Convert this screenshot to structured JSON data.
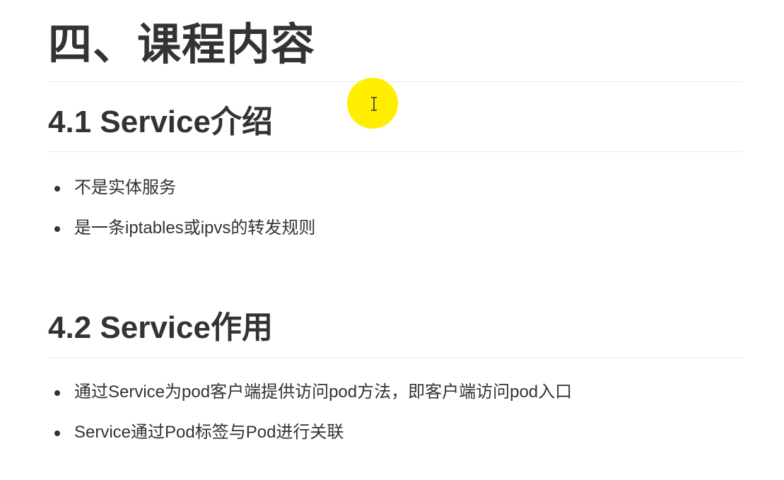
{
  "document": {
    "heading": "四、课程内容",
    "sections": [
      {
        "title": "4.1 Service介绍",
        "bullets": [
          "不是实体服务",
          "是一条iptables或ipvs的转发规则"
        ]
      },
      {
        "title": "4.2 Service作用",
        "bullets": [
          "通过Service为pod客户端提供访问pod方法，即客户端访问pod入口",
          "Service通过Pod标签与Pod进行关联"
        ]
      }
    ]
  },
  "cursor": {
    "icon": "text-ibeam-cursor-icon",
    "highlight_color": "#ffee00"
  }
}
